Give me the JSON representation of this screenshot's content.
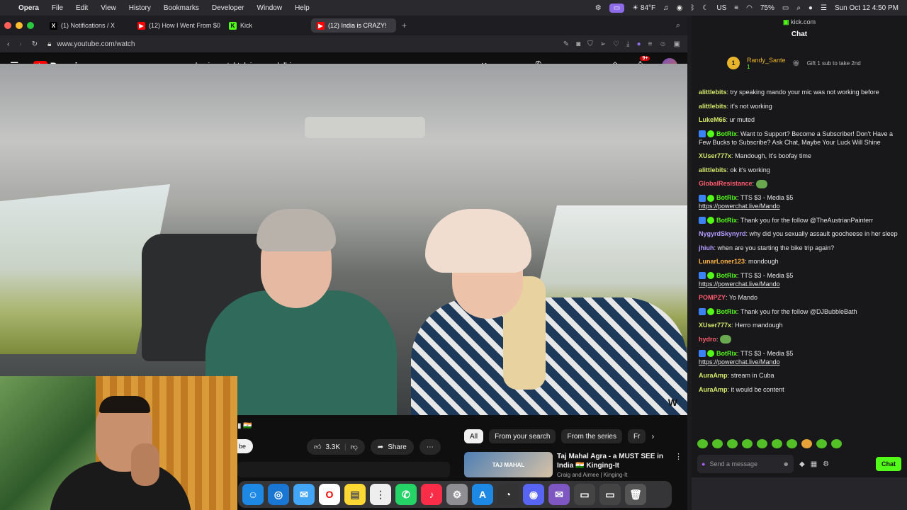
{
  "menubar": {
    "app": "Opera",
    "items": [
      "File",
      "Edit",
      "View",
      "History",
      "Bookmarks",
      "Developer",
      "Window",
      "Help"
    ],
    "weather": "84°F",
    "battery": "75%",
    "clock": "Sun Oct 12  4:50 PM"
  },
  "tabs": [
    {
      "label": "(1) Notifications / X",
      "fav": "X",
      "color": "#000000"
    },
    {
      "label": "(12) How I Went From $0",
      "fav": "▶",
      "color": "#ff0000"
    },
    {
      "label": "Kick",
      "fav": "K",
      "color": "#53fc18"
    },
    {
      "label": "(12) India is CRAZY!",
      "fav": "▶",
      "color": "#ff0000"
    }
  ],
  "address": {
    "url": "www.youtube.com/watch"
  },
  "youtube": {
    "brand": "Premium",
    "region": "TH",
    "search_query": "buying a tuktuk in new delhi",
    "notif_count": "9+",
    "likes": "3.3K",
    "share": "Share",
    "subscribe": "be",
    "chips": [
      "All",
      "From your search",
      "From the series",
      "Fr"
    ],
    "rec": {
      "thumb_text": "TAJ MAHAL",
      "title": "Taj Mahal Agra - a MUST SEE in India 🇮🇳 Kinging-It",
      "channel": "Craig and Aimee | Kinging-It"
    }
  },
  "chat": {
    "site": "kick.com",
    "title": "Chat",
    "pinned_user": "Randy_Sante",
    "pinned_rank": "1",
    "pinned_count": "1",
    "gift_text": "Gift 1 sub to take 2nd",
    "messages": [
      {
        "user": "alittlebits",
        "color": "#d6e96b",
        "text": "try speaking mando your mic was not working before",
        "bot": false,
        "emote": false
      },
      {
        "user": "alittlebits",
        "color": "#d6e96b",
        "text": "it's not working",
        "bot": false,
        "emote": false
      },
      {
        "user": "LukeM66",
        "color": "#d6e96b",
        "text": "ur muted",
        "bot": false,
        "emote": false
      },
      {
        "user": "BotRix",
        "color": "#53fc18",
        "text": "Want to Support? Become a Subscriber! Don't Have a Few Bucks to Subscribe? Ask Chat, Maybe Your Luck Will Shine",
        "bot": true,
        "emote": false
      },
      {
        "user": "XUser777x",
        "color": "#d6e96b",
        "text": "Mandough, It's boofay time",
        "bot": false,
        "emote": false
      },
      {
        "user": "alittlebits",
        "color": "#d6e96b",
        "text": "ok it's working",
        "bot": false,
        "emote": false
      },
      {
        "user": "GlobalResistance",
        "color": "#ff5b6e",
        "text": "",
        "bot": false,
        "emote": true
      },
      {
        "user": "BotRix",
        "color": "#53fc18",
        "text": "TTS $3 - Media $5",
        "link": "https://powerchat.live/Mando",
        "bot": true,
        "emote": false
      },
      {
        "user": "BotRix",
        "color": "#53fc18",
        "text": "Thank you for the follow @TheAustrianPainterr",
        "bot": true,
        "emote": false
      },
      {
        "user": "NygyrdSkynyrd",
        "color": "#b59bff",
        "text": "why did you sexually assault goocheese in her sleep",
        "bot": false,
        "emote": false
      },
      {
        "user": "jhiuh",
        "color": "#b59bff",
        "text": "when are you starting the bike trip again?",
        "bot": false,
        "emote": false
      },
      {
        "user": "LunarLoner123",
        "color": "#ffb347",
        "text": "mondough",
        "bot": false,
        "emote": false
      },
      {
        "user": "BotRix",
        "color": "#53fc18",
        "text": "TTS $3 - Media $5",
        "link": "https://powerchat.live/Mando",
        "bot": true,
        "emote": false
      },
      {
        "user": "POMPZY",
        "color": "#ff5b6e",
        "text": "Yo Mando",
        "bot": false,
        "emote": false
      },
      {
        "user": "BotRix",
        "color": "#53fc18",
        "text": "Thank you for the follow @DJBubbleBath",
        "bot": true,
        "emote": false
      },
      {
        "user": "XUser777x",
        "color": "#d6e96b",
        "text": "Herro mandough",
        "bot": false,
        "emote": false
      },
      {
        "user": "hydro",
        "color": "#ff5b6e",
        "text": "",
        "bot": false,
        "emote": true
      },
      {
        "user": "BotRix",
        "color": "#53fc18",
        "text": "TTS $3 - Media $5",
        "link": "https://powerchat.live/Mando",
        "bot": true,
        "emote": false
      },
      {
        "user": "AuraAmp",
        "color": "#d6e96b",
        "text": "stream in Cuba",
        "bot": false,
        "emote": false
      },
      {
        "user": "AuraAmp",
        "color": "#d6e96b",
        "text": "it would be content",
        "bot": false,
        "emote": false
      }
    ],
    "input_placeholder": "Send a message",
    "send_label": "Chat"
  }
}
